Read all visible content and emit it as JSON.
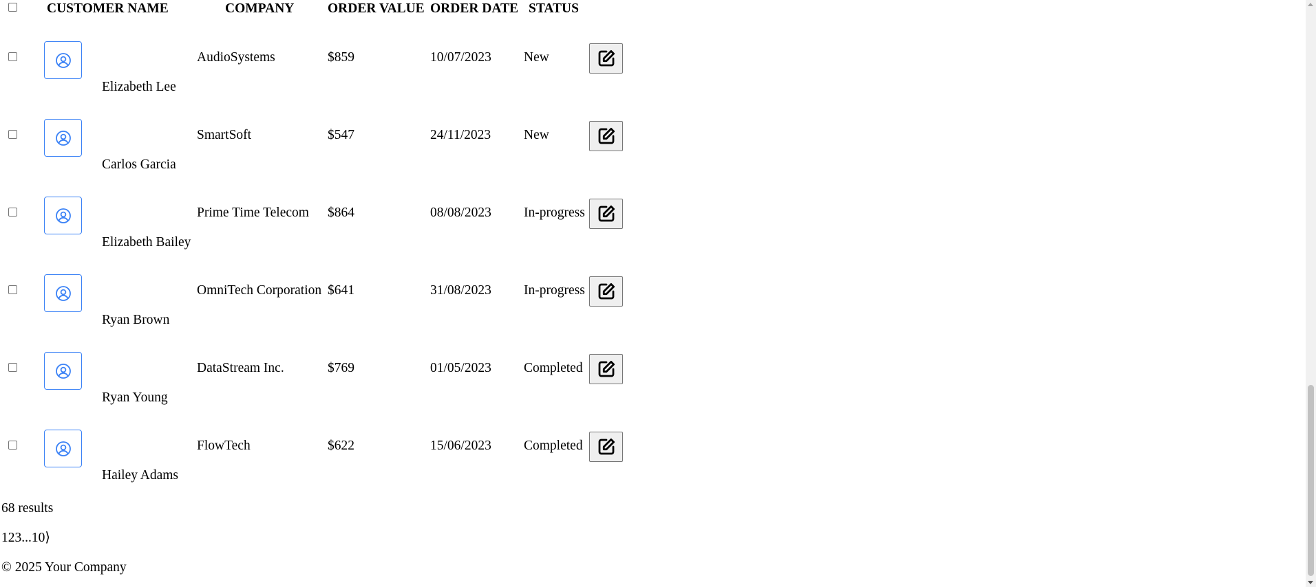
{
  "table": {
    "headers": {
      "customer_name": "CUSTOMER NAME",
      "company": "COMPANY",
      "order_value": "ORDER VALUE",
      "order_date": "ORDER DATE",
      "status": "STATUS"
    },
    "rows": [
      {
        "customer_name": "Elizabeth Lee",
        "company": "AudioSystems",
        "order_value": "$859",
        "order_date": "10/07/2023",
        "status": "New"
      },
      {
        "customer_name": "Carlos Garcia",
        "company": "SmartSoft",
        "order_value": "$547",
        "order_date": "24/11/2023",
        "status": "New"
      },
      {
        "customer_name": "Elizabeth Bailey",
        "company": "Prime Time Telecom",
        "order_value": "$864",
        "order_date": "08/08/2023",
        "status": "In-progress"
      },
      {
        "customer_name": "Ryan Brown",
        "company": "OmniTech Corporation",
        "order_value": "$641",
        "order_date": "31/08/2023",
        "status": "In-progress"
      },
      {
        "customer_name": "Ryan Young",
        "company": "DataStream Inc.",
        "order_value": "$769",
        "order_date": "01/05/2023",
        "status": "Completed"
      },
      {
        "customer_name": "Hailey Adams",
        "company": "FlowTech",
        "order_value": "$622",
        "order_date": "15/06/2023",
        "status": "Completed"
      }
    ],
    "avatar_icon": "user-circle-icon",
    "edit_icon": "edit-icon"
  },
  "results": {
    "count_text": "68 results"
  },
  "pagination": {
    "text": "123...10⟩"
  },
  "footer": {
    "copyright": "© 2025 Your Company"
  },
  "colors": {
    "avatar_accent": "#3b82f6",
    "button_bg": "#efefef"
  }
}
